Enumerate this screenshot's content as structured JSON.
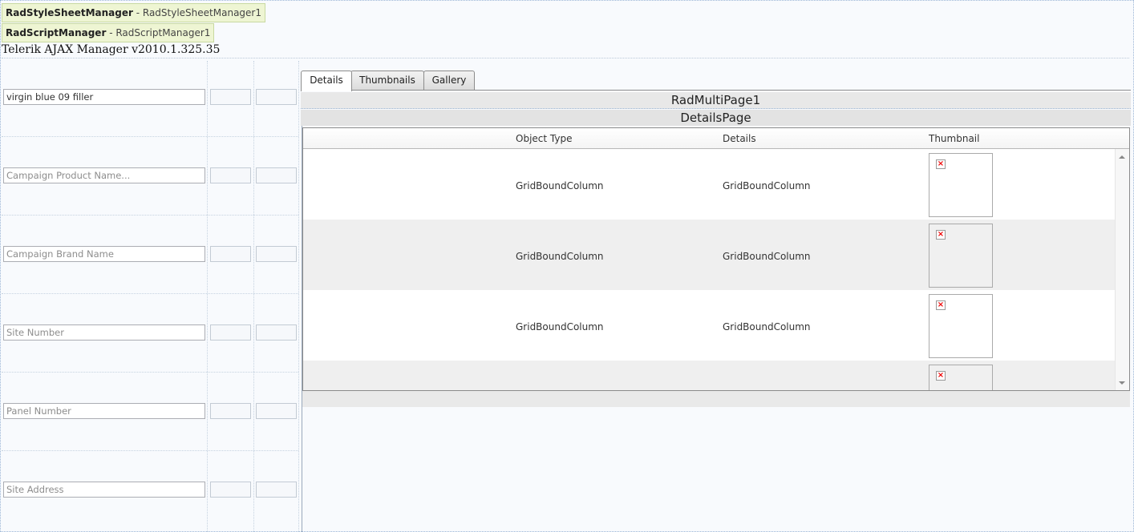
{
  "managers": {
    "style": {
      "type": "RadStyleSheetManager",
      "separator": " - ",
      "id": "RadStyleSheetManager1"
    },
    "script": {
      "type": "RadScriptManager",
      "separator": " - ",
      "id": "RadScriptManager1"
    }
  },
  "ajax_manager_text": "Telerik AJAX Manager v2010.1.325.35",
  "form": {
    "fields": [
      {
        "value": "virgin blue 09 filler",
        "placeholder": ""
      },
      {
        "value": "",
        "placeholder": "Campaign Product Name..."
      },
      {
        "value": "",
        "placeholder": "Campaign Brand Name"
      },
      {
        "value": "",
        "placeholder": "Site Number"
      },
      {
        "value": "",
        "placeholder": "Panel Number"
      },
      {
        "value": "",
        "placeholder": "Site Address"
      }
    ]
  },
  "tabs": [
    {
      "label": "Details",
      "selected": true
    },
    {
      "label": "Thumbnails",
      "selected": false
    },
    {
      "label": "Gallery",
      "selected": false
    }
  ],
  "multipage": {
    "label": "RadMultiPage1",
    "page_label": "DetailsPage"
  },
  "grid": {
    "columns": [
      "Object Type",
      "Details",
      "Thumbnail"
    ],
    "rows": [
      {
        "object_type": "GridBoundColumn",
        "details": "GridBoundColumn"
      },
      {
        "object_type": "GridBoundColumn",
        "details": "GridBoundColumn"
      },
      {
        "object_type": "GridBoundColumn",
        "details": "GridBoundColumn"
      },
      {
        "object_type": "",
        "details": ""
      }
    ],
    "broken_image_glyph": "×"
  },
  "colors": {
    "manager_tag_bg": "#eef5d3",
    "grid_alt_row": "#efefef",
    "broken_icon": "#ee0000"
  }
}
